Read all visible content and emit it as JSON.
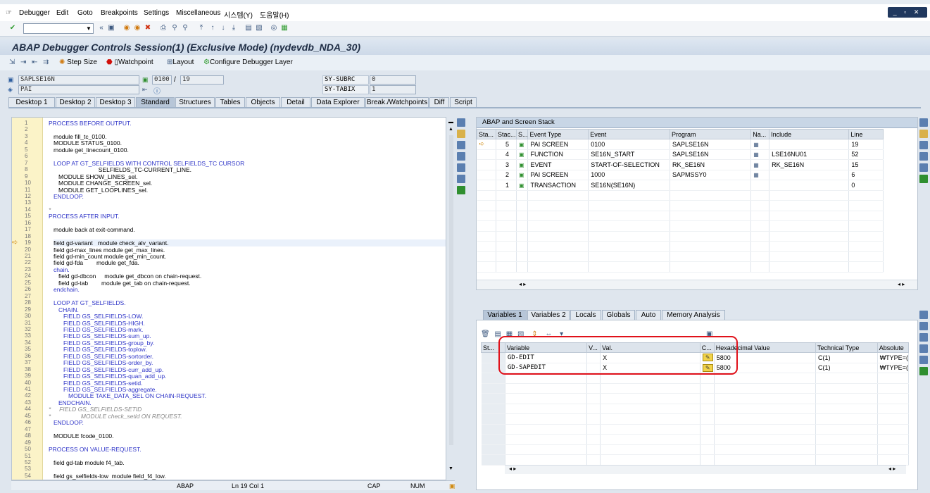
{
  "menu": [
    "Debugger",
    "Edit",
    "Goto",
    "Breakpoints",
    "Settings",
    "Miscellaneous",
    "시스템(Y)",
    "도움말(H)"
  ],
  "title": "ABAP Debugger Controls Session(1)  (Exclusive Mode) (nydevdb_NDA_30)",
  "toolbar2": {
    "step_size": "Step Size",
    "watchpoint": "Watchpoint",
    "layout": "Layout",
    "configure": "Configure Debugger Layer"
  },
  "header": {
    "program": "SAPLSE16N",
    "block": "PAI",
    "line_cur": "0100",
    "line_total": "19",
    "subrc_label": "SY-SUBRC",
    "subrc_value": "0",
    "tabix_label": "SY-TABIX",
    "tabix_value": "1"
  },
  "desktop_tabs": [
    "Desktop 1",
    "Desktop 2",
    "Desktop 3",
    "Standard",
    "Structures",
    "Tables",
    "Objects",
    "Detail",
    "Data Explorer",
    "Break./Watchpoints",
    "Diff",
    "Script"
  ],
  "editor": {
    "lines": [
      {
        "n": "1",
        "t": "PROCESS BEFORE OUTPUT.",
        "k": "kw",
        "i": 0
      },
      {
        "n": "2",
        "t": "",
        "k": "",
        "i": 0
      },
      {
        "n": "3",
        "t": "module fill_tc_0100.",
        "k": "",
        "i": 1
      },
      {
        "n": "4",
        "t": "MODULE STATUS_0100.",
        "k": "",
        "i": 1
      },
      {
        "n": "5",
        "t": "module get_linecount_0100.",
        "k": "",
        "i": 1
      },
      {
        "n": "6",
        "t": "",
        "k": "",
        "i": 0
      },
      {
        "n": "7",
        "t": "LOOP AT GT_SELFIELDS WITH CONTROL SELFIELDS_TC CURSOR",
        "k": "kw",
        "i": 1
      },
      {
        "n": "8",
        "t": "                           SELFIELDS_TC-CURRENT_LINE.",
        "k": "",
        "i": 1
      },
      {
        "n": "9",
        "t": "MODULE SHOW_LINES_sel.",
        "k": "",
        "i": 2
      },
      {
        "n": "10",
        "t": "MODULE CHANGE_SCREEN_sel.",
        "k": "",
        "i": 2
      },
      {
        "n": "11",
        "t": "MODULE GET_LOOPLINES_sel.",
        "k": "",
        "i": 2
      },
      {
        "n": "12",
        "t": "ENDLOOP.",
        "k": "kw",
        "i": 1
      },
      {
        "n": "13",
        "t": "",
        "k": "",
        "i": 0
      },
      {
        "n": "14",
        "t": "*",
        "k": "cm",
        "i": 0
      },
      {
        "n": "15",
        "t": "PROCESS AFTER INPUT.",
        "k": "kw",
        "i": 0
      },
      {
        "n": "16",
        "t": "",
        "k": "",
        "i": 0
      },
      {
        "n": "17",
        "t": "module back at exit-command.",
        "k": "",
        "i": 1
      },
      {
        "n": "18",
        "t": "",
        "k": "",
        "i": 0
      },
      {
        "n": "19",
        "t": "field gd-variant   module check_alv_variant.",
        "k": "",
        "i": 1
      },
      {
        "n": "20",
        "t": "field gd-max_lines module get_max_lines.",
        "k": "",
        "i": 1
      },
      {
        "n": "21",
        "t": "field gd-min_count module get_min_count.",
        "k": "",
        "i": 1
      },
      {
        "n": "22",
        "t": "field gd-fda        module get_fda.",
        "k": "",
        "i": 1
      },
      {
        "n": "23",
        "t": "chain.",
        "k": "kw",
        "i": 1
      },
      {
        "n": "24",
        "t": "field gd-dbcon     module get_dbcon on chain-request.",
        "k": "",
        "i": 2
      },
      {
        "n": "25",
        "t": "field gd-tab        module get_tab on chain-request.",
        "k": "",
        "i": 2
      },
      {
        "n": "26",
        "t": "endchain.",
        "k": "kw",
        "i": 1
      },
      {
        "n": "27",
        "t": "",
        "k": "",
        "i": 0
      },
      {
        "n": "28",
        "t": "LOOP AT GT_SELFIELDS.",
        "k": "kw",
        "i": 1
      },
      {
        "n": "29",
        "t": "CHAIN.",
        "k": "kw",
        "i": 2
      },
      {
        "n": "30",
        "t": "FIELD GS_SELFIELDS-LOW.",
        "k": "kw",
        "i": 3
      },
      {
        "n": "31",
        "t": "FIELD GS_SELFIELDS-HIGH.",
        "k": "kw",
        "i": 3
      },
      {
        "n": "32",
        "t": "FIELD GS_SELFIELDS-mark.",
        "k": "kw",
        "i": 3
      },
      {
        "n": "33",
        "t": "FIELD GS_SELFIELDS-sum_up.",
        "k": "kw",
        "i": 3
      },
      {
        "n": "34",
        "t": "FIELD GS_SELFIELDS-group_by.",
        "k": "kw",
        "i": 3
      },
      {
        "n": "35",
        "t": "FIELD GS_SELFIELDS-toplow.",
        "k": "kw",
        "i": 3
      },
      {
        "n": "36",
        "t": "FIELD GS_SELFIELDS-sortorder.",
        "k": "kw",
        "i": 3
      },
      {
        "n": "37",
        "t": "FIELD GS_SELFIELDS-order_by.",
        "k": "kw",
        "i": 3
      },
      {
        "n": "38",
        "t": "FIELD GS_SELFIELDS-curr_add_up.",
        "k": "kw",
        "i": 3
      },
      {
        "n": "39",
        "t": "FIELD GS_SELFIELDS-quan_add_up.",
        "k": "kw",
        "i": 3
      },
      {
        "n": "40",
        "t": "FIELD GS_SELFIELDS-setid.",
        "k": "kw",
        "i": 3
      },
      {
        "n": "41",
        "t": "FIELD GS_SELFIELDS-aggregate.",
        "k": "kw",
        "i": 3
      },
      {
        "n": "42",
        "t": "MODULE TAKE_DATA_SEL ON CHAIN-REQUEST.",
        "k": "kw",
        "i": 4
      },
      {
        "n": "43",
        "t": "ENDCHAIN.",
        "k": "kw",
        "i": 2
      },
      {
        "n": "44",
        "t": "*     FIELD GS_SELFIELDS-SETID",
        "k": "cm",
        "i": 0
      },
      {
        "n": "45",
        "t": "*                  MODULE check_setid ON REQUEST.",
        "k": "cm",
        "i": 0
      },
      {
        "n": "46",
        "t": "ENDLOOP.",
        "k": "kw",
        "i": 1
      },
      {
        "n": "47",
        "t": "",
        "k": "",
        "i": 0
      },
      {
        "n": "48",
        "t": "MODULE fcode_0100.",
        "k": "",
        "i": 1
      },
      {
        "n": "49",
        "t": "",
        "k": "",
        "i": 0
      },
      {
        "n": "50",
        "t": "PROCESS ON VALUE-REQUEST.",
        "k": "kw",
        "i": 0
      },
      {
        "n": "51",
        "t": "",
        "k": "",
        "i": 0
      },
      {
        "n": "52",
        "t": "field gd-tab module f4_tab.",
        "k": "",
        "i": 1
      },
      {
        "n": "53",
        "t": "",
        "k": "",
        "i": 0
      },
      {
        "n": "54",
        "t": "field gs_selfields-low  module field_f4_low.",
        "k": "",
        "i": 1
      }
    ]
  },
  "statusbar": {
    "lang": "ABAP",
    "pos": "Ln  19 Col  1",
    "cap": "CAP",
    "num": "NUM"
  },
  "stack": {
    "title": "ABAP and Screen Stack",
    "headers": [
      "Sta...",
      "Stac...",
      "S...",
      "Event Type",
      "Event",
      "Program",
      "Na...",
      "Include",
      "Line"
    ],
    "rows": [
      [
        "➪",
        "5",
        "",
        "PAI SCREEN",
        "0100",
        "SAPLSE16N",
        "",
        "",
        "19"
      ],
      [
        "",
        "4",
        "",
        "FUNCTION",
        "SE16N_START",
        "SAPLSE16N",
        "",
        "LSE16NU01",
        "52"
      ],
      [
        "",
        "3",
        "",
        "EVENT",
        "START-OF-SELECTION",
        "RK_SE16N",
        "",
        "RK_SE16N",
        "15"
      ],
      [
        "",
        "2",
        "",
        "PAI SCREEN",
        "1000",
        "SAPMSSY0",
        "",
        "",
        "6"
      ],
      [
        "",
        "1",
        "",
        "TRANSACTION",
        "SE16N(SE16N)",
        "",
        "",
        "",
        "0"
      ]
    ]
  },
  "var_tabs": [
    "Variables 1",
    "Variables 2",
    "Locals",
    "Globals",
    "Auto",
    "Memory Analysis"
  ],
  "vars": {
    "headers": [
      "St...",
      "Variable",
      "V...",
      "Val.",
      "C...",
      "Hexadecimal Value",
      "Technical Type",
      "Absolute"
    ],
    "rows": [
      [
        "",
        "GD-EDIT",
        "",
        "X",
        "",
        "5800",
        "C(1)",
        "₩TYPE=("
      ],
      [
        "",
        "GD-SAPEDIT",
        "",
        "X",
        "",
        "5800",
        "C(1)",
        "₩TYPE=("
      ]
    ]
  }
}
